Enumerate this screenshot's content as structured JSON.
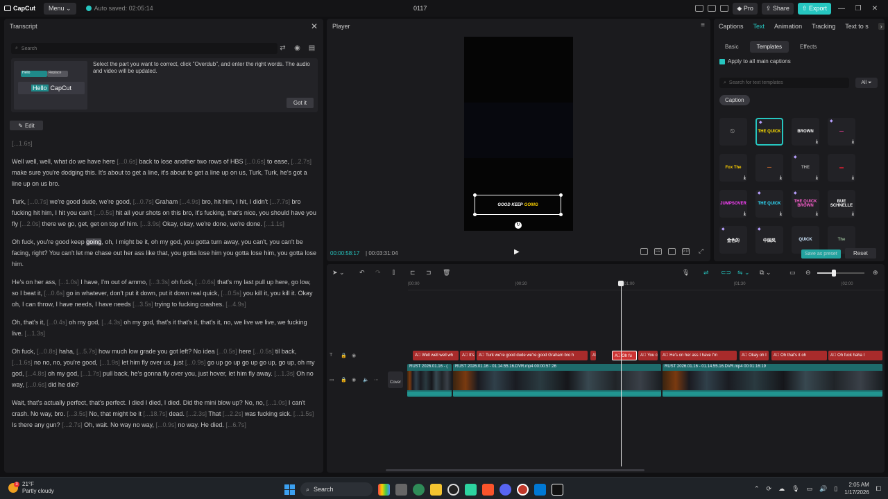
{
  "titlebar": {
    "logo": "CapCut",
    "menu": "Menu",
    "autosave": "Auto saved: 02:05:14",
    "project": "0117",
    "pro": "Pro",
    "share": "Share",
    "export": "Export"
  },
  "transcript": {
    "title": "Transcript",
    "search_placeholder": "Search",
    "tip": {
      "tag1": "Hello",
      "tag2": "Replace",
      "hello_hl": "Hello",
      "hello_rest": "CapCut",
      "text": "Select the part you want to correct, click \"Overdub\", and enter the right words. The audio and video will be updated.",
      "button": "Got it"
    },
    "edit": "Edit",
    "first_gap": "[...1.6s]",
    "paragraphs": [
      [
        [
          "Well well, well, what do we have here ",
          0
        ],
        [
          "[...0.6s]",
          1
        ],
        [
          " back to lose another two rows of HBS ",
          0
        ],
        [
          "[...0.6s]",
          1
        ],
        [
          " to ease, ",
          0
        ],
        [
          "[...2.7s]",
          1
        ],
        [
          " make sure you're dodging this. It's about to get a line, it's about to get a line up on us, Turk, Turk, he's got a line up on us bro.",
          0
        ]
      ],
      [
        [
          "Turk, ",
          0
        ],
        [
          "[...0.7s]",
          1
        ],
        [
          " we're good dude, we're good, ",
          0
        ],
        [
          "[...0.7s]",
          1
        ],
        [
          " Graham ",
          0
        ],
        [
          "[...4.9s]",
          1
        ],
        [
          " bro, hit him, I hit, I didn't ",
          0
        ],
        [
          "[...7.7s]",
          1
        ],
        [
          " bro fucking hit him, I hit you can't ",
          0
        ],
        [
          "[...0.5s]",
          1
        ],
        [
          " hit all your shots on this bro, it's fucking, that's nice, you should have you fly ",
          0
        ],
        [
          "[...2.0s]",
          1
        ],
        [
          " there we go, get, get on top of him. ",
          0
        ],
        [
          "[...3.9s]",
          1
        ],
        [
          " Okay, okay, we're done, we're done. ",
          0
        ],
        [
          "[...1.1s]",
          1
        ]
      ],
      [
        [
          "Oh fuck, you're good keep ",
          0
        ],
        [
          "going",
          2
        ],
        [
          ", oh, I might be it, oh my god, you gotta turn away, you can't, you can't be facing, right? You can't let me chase out her ass like that, you gotta lose him you gotta lose him, you gotta lose him.",
          0
        ]
      ],
      [
        [
          "He's on her ass, ",
          0
        ],
        [
          "[...1.0s]",
          1
        ],
        [
          " I have, I'm out of ammo, ",
          0
        ],
        [
          "[...3.3s]",
          1
        ],
        [
          " oh fuck, ",
          0
        ],
        [
          "[...0.6s]",
          1
        ],
        [
          " that's my last pull up here, go low, so I beat it, ",
          0
        ],
        [
          "[...0.6s]",
          1
        ],
        [
          " go in whatever, don't put it down, put it down real quick, ",
          0
        ],
        [
          "[...0.5s]",
          1
        ],
        [
          " you kill it, you kill it. Okay oh, I can throw, I have needs, I have needs ",
          0
        ],
        [
          "[...3.5s]",
          1
        ],
        [
          " trying to fucking crashes. ",
          0
        ],
        [
          "[...4.9s]",
          1
        ]
      ],
      [
        [
          "Oh, that's it, ",
          0
        ],
        [
          "[...0.4s]",
          1
        ],
        [
          " oh my god, ",
          0
        ],
        [
          "[...4.3s]",
          1
        ],
        [
          " oh my god, that's it that's it, that's it, no, we live we live, we fucking live. ",
          0
        ],
        [
          "[...1.3s]",
          1
        ]
      ],
      [
        [
          "Oh fuck, ",
          0
        ],
        [
          "[...0.8s]",
          1
        ],
        [
          " haha, ",
          0
        ],
        [
          "[...5.7s]",
          1
        ],
        [
          " how much low grade you got left? No idea ",
          0
        ],
        [
          "[...0.5s]",
          1
        ],
        [
          " here ",
          0
        ],
        [
          "[...0.5s]",
          1
        ],
        [
          " til back, ",
          0
        ],
        [
          "[...1.6s]",
          1
        ],
        [
          " no no, no, you're good, ",
          0
        ],
        [
          "[...1.9s]",
          1
        ],
        [
          " let him fly over us, just ",
          0
        ],
        [
          "[...0.9s]",
          1
        ],
        [
          " go up go up go up go up, go up, oh my god, ",
          0
        ],
        [
          "[...4.8s]",
          1
        ],
        [
          " oh my god, ",
          0
        ],
        [
          "[...1.7s]",
          1
        ],
        [
          " pull back, he's gonna fly over you, just hover, let him fly away. ",
          0
        ],
        [
          "[...1.3s]",
          1
        ],
        [
          " Oh no way, ",
          0
        ],
        [
          "[...0.6s]",
          1
        ],
        [
          " did he die?",
          0
        ]
      ],
      [
        [
          "Wait, that's actually perfect, that's perfect. I died I died, I died. Did the mini blow up? No, no, ",
          0
        ],
        [
          "[...1.0s]",
          1
        ],
        [
          " I can't crash. No way, bro. ",
          0
        ],
        [
          "[...3.5s]",
          1
        ],
        [
          " No, that might be it ",
          0
        ],
        [
          "[...18.7s]",
          1
        ],
        [
          " dead. ",
          0
        ],
        [
          "[...2.3s]",
          1
        ],
        [
          " That ",
          0
        ],
        [
          "[...2.2s]",
          1
        ],
        [
          " was fucking sick. ",
          0
        ],
        [
          "[...1.5s]",
          1
        ],
        [
          " Is there any gun? ",
          0
        ],
        [
          "[...2.7s]",
          1
        ],
        [
          " Oh, wait. No way no way, ",
          0
        ],
        [
          "[...0.9s]",
          1
        ],
        [
          " no way. He died. ",
          0
        ],
        [
          "[...6.7s]",
          1
        ]
      ]
    ]
  },
  "player": {
    "title": "Player",
    "caption_white": "GOOD KEEP",
    "caption_yellow": "GOING",
    "time_current": "00:00:58:17",
    "time_total": "00:03:31:04"
  },
  "props": {
    "tabs": [
      "Captions",
      "Text",
      "Animation",
      "Tracking",
      "Text to s"
    ],
    "active_tab": "Text",
    "subtabs": [
      "Basic",
      "Templates",
      "Effects"
    ],
    "active_subtab": "Templates",
    "apply_all": "Apply to all main captions",
    "search_placeholder": "Search for text templates",
    "all_filter": "All",
    "category": "Caption",
    "templates": [
      {
        "label": "⃠",
        "color": "#888888"
      },
      {
        "label": "THE QUICK",
        "color": "#ffe000"
      },
      {
        "label": "BROWN",
        "color": "#ffffff"
      },
      {
        "label": "—",
        "color": "#ff40a0"
      },
      {
        "label": "Fox The",
        "color": "#ffd000"
      },
      {
        "label": "—",
        "color": "#ff8030"
      },
      {
        "label": "THE",
        "color": "#aaaaaa"
      },
      {
        "label": "▬",
        "color": "#cc2030"
      },
      {
        "label": "JUMPSOVER",
        "color": "#ff40ff"
      },
      {
        "label": "THE QUICK",
        "color": "#30e0ff"
      },
      {
        "label": "THE QUICK BROWN",
        "color": "#ff60d0"
      },
      {
        "label": "BUE SCHNELLE",
        "color": "#ffffff"
      },
      {
        "label": "金色的",
        "color": "#ffffff"
      },
      {
        "label": "中国风",
        "color": "#ffffff"
      },
      {
        "label": "QUICK",
        "color": "#d0e8ff"
      },
      {
        "label": "The",
        "color": "#90b090"
      }
    ],
    "save_preset": "Save as preset",
    "reset": "Reset"
  },
  "timeline": {
    "ticks": [
      "|00:00",
      "|00:30",
      "|01:00",
      "|01:30",
      "|02:00"
    ],
    "cover": "Cover",
    "captions": [
      "Well well well wh",
      "It's",
      "Turk we're good dude we're good Graham bro h",
      "A",
      "Oh fu",
      "You c",
      "He's on her ass I have I'm",
      "Okay oh I",
      "Oh that's it oh",
      "Oh fuck haha I"
    ],
    "clips": [
      "RUST 2026.01.16 - (",
      "RUST 2026.01.16 - 01.14.55.16.DVR.mp4  00:00:57:26",
      "RUST 2026.01.16 - 01.14.55.16.DVR.mp4  00:01:16:19"
    ]
  },
  "taskbar": {
    "temp": "21°F",
    "weather": "Partly cloudy",
    "weather_badge": "3",
    "search": "Search",
    "time": "2:05 AM",
    "date": "1/17/2026"
  }
}
